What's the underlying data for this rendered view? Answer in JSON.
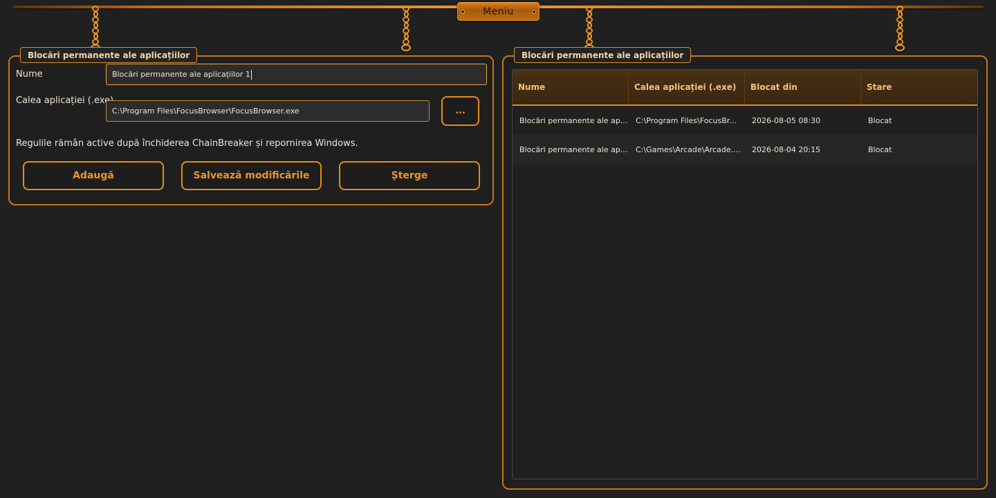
{
  "topbar": {
    "menu_label": "Meniu"
  },
  "editor": {
    "group_title": "Blocări permanente ale aplicațiilor",
    "name_label": "Nume",
    "name_value": "Blocări permanente ale aplicațiilor 1",
    "path_label": "Calea aplicației (.exe)",
    "path_value": "C:\\Program Files\\FocusBrowser\\FocusBrowser.exe",
    "browse_label": "...",
    "note": "Regulile rămân active după închiderea ChainBreaker și repornirea Windows.",
    "add_label": "Adaugă",
    "save_label": "Salvează modificările",
    "delete_label": "Șterge"
  },
  "list": {
    "group_title": "Blocări permanente ale aplicațiilor",
    "columns": [
      "Nume",
      "Calea aplicației (.exe)",
      "Blocat din",
      "Stare"
    ],
    "rows": [
      [
        "Blocări permanente ale ap...",
        "C:\\Program Files\\FocusBr...",
        "2026-08-05 08:30",
        "Blocat"
      ],
      [
        "Blocări permanente ale ap...",
        "C:\\Games\\Arcade\\Arcade....",
        "2026-08-04 20:15",
        "Blocat"
      ]
    ]
  },
  "colors": {
    "accent": "#e88b16",
    "background": "#202020",
    "text": "#f0e6d2"
  }
}
